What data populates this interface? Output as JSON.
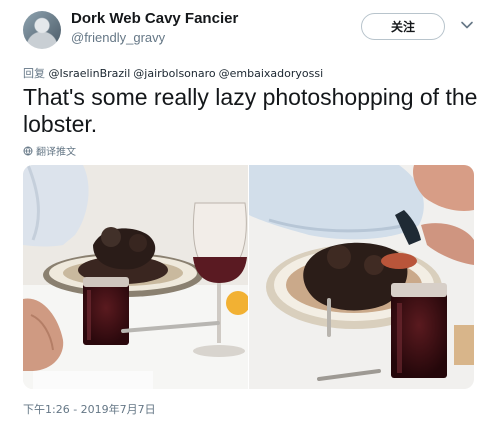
{
  "tweet": {
    "author": {
      "display_name": "Dork Web Cavy Fancier",
      "handle": "@friendly_gravy",
      "avatar_icon": "user-avatar"
    },
    "follow_label": "关注",
    "menu_icon": "chevron-down-icon",
    "reply_prefix": "回复",
    "mentions": [
      "@IsraelinBrazil",
      "@jairbolsonaro",
      "@embaixadoryossi"
    ],
    "text": "That's some really lazy photoshopping of the lobster.",
    "translate_label": "翻译推文",
    "translate_icon": "globe-icon",
    "timestamp": "下午1:26 - 2019年7月7日",
    "media": [
      {
        "icon": "photo-left"
      },
      {
        "icon": "photo-right"
      }
    ]
  },
  "colors": {
    "text_primary": "#14171a",
    "text_secondary": "#657786",
    "border": "#b8c4cc"
  }
}
